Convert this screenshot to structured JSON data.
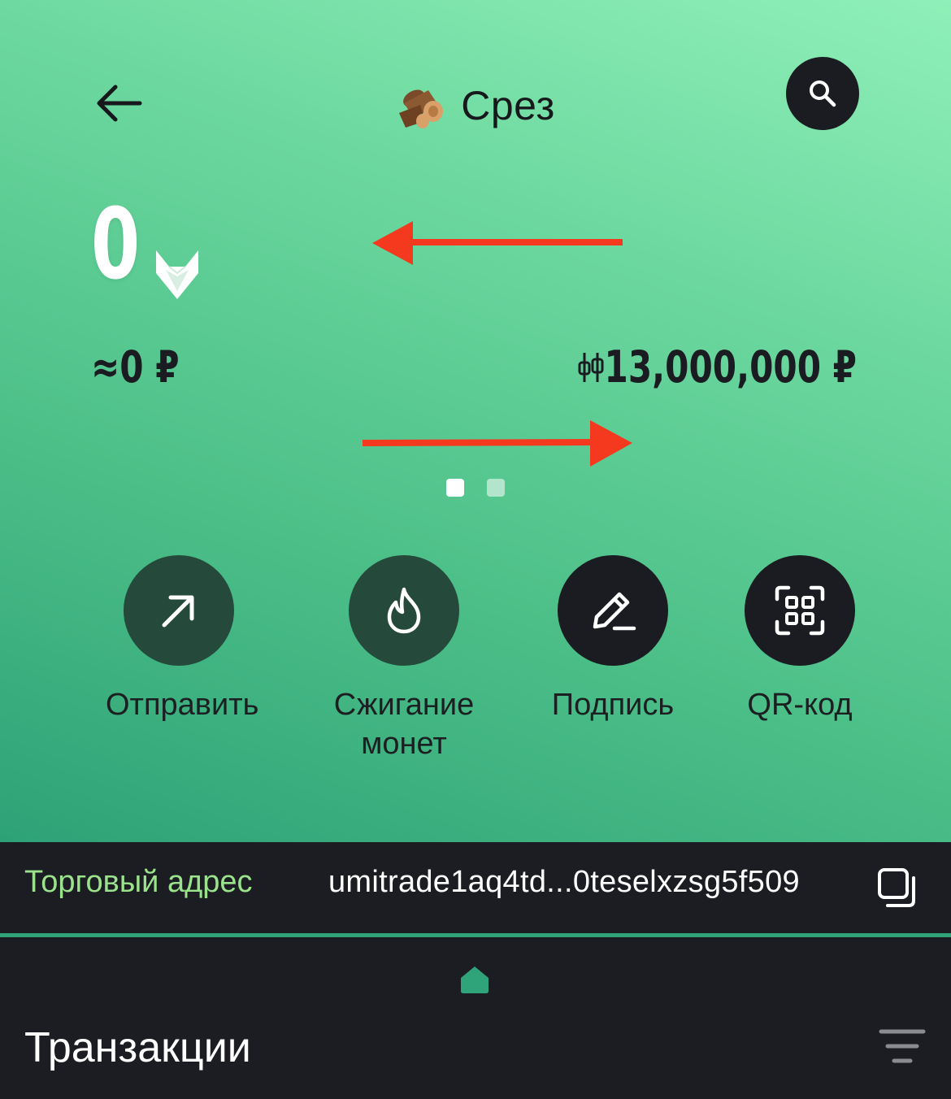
{
  "header": {
    "title": "Срез",
    "back_icon": "arrow-left-icon",
    "title_icon": "wood-logs-icon",
    "search_icon": "search-icon"
  },
  "balance": {
    "amount": "0",
    "token_icon": "fox-logo-icon",
    "fiat_approx": "≈0 ₽",
    "market_cap_icon": "candlestick-icon",
    "market_cap": "13,000,000 ₽"
  },
  "pager": {
    "pages": 2,
    "active_index": 0
  },
  "actions": [
    {
      "label": "Отправить",
      "icon": "arrow-up-right-icon"
    },
    {
      "label": "Сжигание монет",
      "icon": "flame-icon"
    },
    {
      "label": "Подпись",
      "icon": "pen-icon"
    },
    {
      "label": "QR-код",
      "icon": "qr-code-icon"
    }
  ],
  "address": {
    "label": "Торговый адрес",
    "value": "umitrade1aq4td...0teselxzsg5f509",
    "copy_icon": "copy-icon"
  },
  "nav": {
    "home_icon": "home-icon"
  },
  "transactions": {
    "title": "Транзакции",
    "filter_icon": "filter-icon"
  },
  "colors": {
    "hero_gradient_top": "#8ff0b8",
    "hero_gradient_bottom": "#2ea277",
    "dark": "#1c1d22",
    "address_label": "#9ae38c",
    "accent": "#2fa37a",
    "annotation_arrow": "#f4391e"
  }
}
